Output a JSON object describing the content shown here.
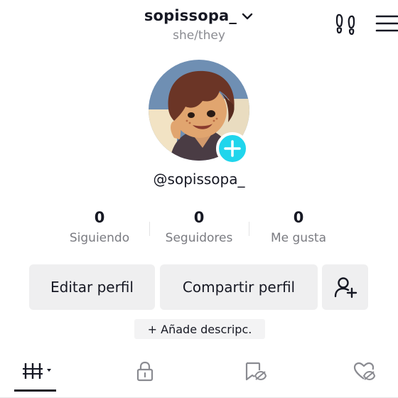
{
  "header": {
    "username": "sopissopa_",
    "pronouns": "she/they",
    "icons": [
      "chevron-down-icon",
      "footprints-icon",
      "hamburger-menu-icon"
    ]
  },
  "profile": {
    "handle": "@sopissopa_",
    "avatar_icon": "avatar-illustration",
    "add_icon": "plus-circle-icon",
    "accent_color": "#20d5ec"
  },
  "stats": [
    {
      "value": "0",
      "label": "Siguiendo"
    },
    {
      "value": "0",
      "label": "Seguidores"
    },
    {
      "value": "0",
      "label": "Me gusta"
    }
  ],
  "actions": {
    "edit_label": "Editar perfil",
    "share_label": "Compartir perfil",
    "add_friend_icon": "add-user-icon"
  },
  "bio": {
    "add_description_label": "+ Añade descripc."
  },
  "tabs": [
    {
      "name": "videos-grid-icon",
      "active": true
    },
    {
      "name": "lock-icon",
      "active": false
    },
    {
      "name": "saved-hidden-icon",
      "active": false
    },
    {
      "name": "liked-hidden-icon",
      "active": false
    }
  ]
}
